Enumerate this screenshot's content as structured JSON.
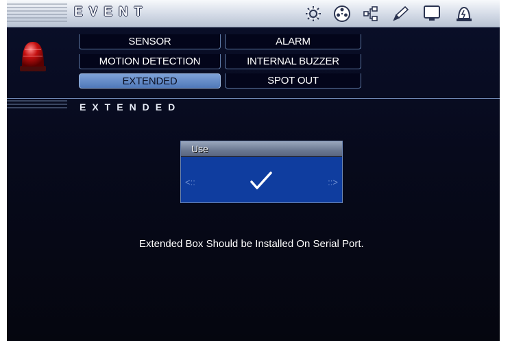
{
  "window": {
    "title": "EVENT"
  },
  "toolbar": {
    "icons": [
      "gear-icon",
      "reel-icon",
      "network-icon",
      "pencil-icon",
      "monitor-icon",
      "alarm-bell-icon"
    ]
  },
  "tabs": [
    {
      "label": "SENSOR",
      "active": false
    },
    {
      "label": "ALARM",
      "active": false
    },
    {
      "label": "MOTION DETECTION",
      "active": false
    },
    {
      "label": "INTERNAL BUZZER",
      "active": false
    },
    {
      "label": "EXTENDED",
      "active": true
    },
    {
      "label": "SPOT OUT",
      "active": false
    }
  ],
  "section": {
    "title": "EXTENDED"
  },
  "use_control": {
    "label": "Use",
    "checked": true,
    "left_arrow": "<::",
    "right_arrow": "::>"
  },
  "message": "Extended Box Should be Installed On Serial Port.",
  "colors": {
    "title_bar": "#d3dae6",
    "active_tab": "#5f86c4",
    "use_body": "#0f3d9f",
    "background": "#070a1c"
  }
}
